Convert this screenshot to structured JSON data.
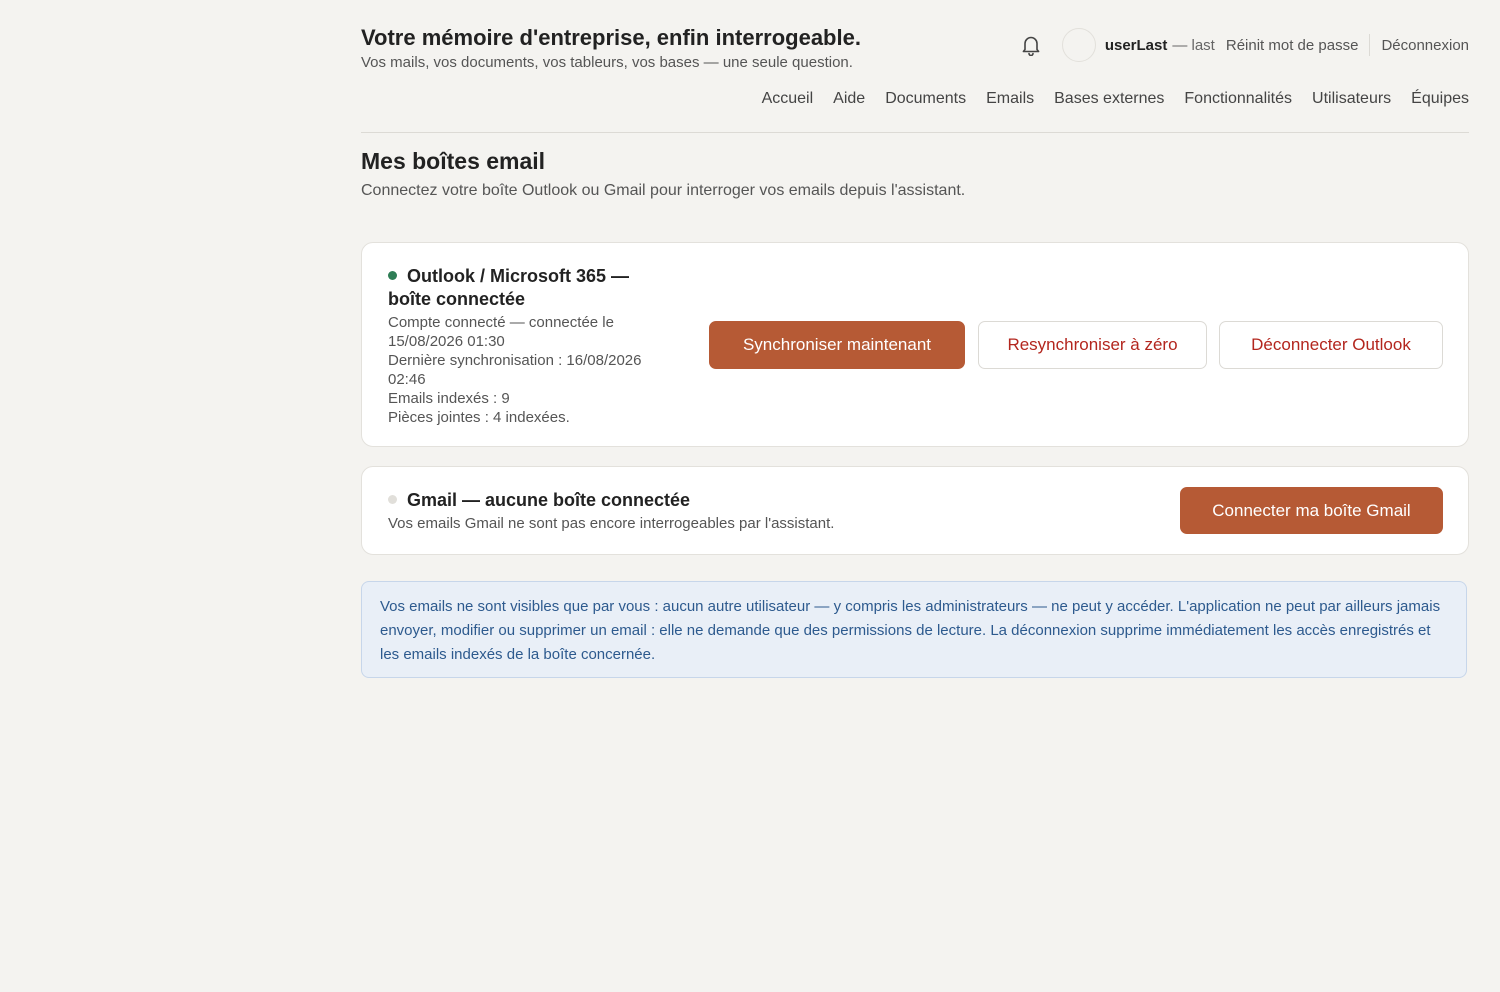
{
  "header": {
    "title": "Votre mémoire d'entreprise, enfin interrogeable.",
    "subtitle": "Vos mails, vos documents, vos tableurs, vos bases — une seule question.",
    "user": {
      "name": "userLast",
      "suffix": "— last",
      "reset_password": "Réinit mot de passe",
      "logout": "Déconnexion"
    },
    "nav": [
      "Accueil",
      "Aide",
      "Documents",
      "Emails",
      "Bases externes",
      "Fonctionnalités",
      "Utilisateurs",
      "Équipes"
    ]
  },
  "section": {
    "title": "Mes boîtes email",
    "description": "Connectez votre boîte Outlook ou Gmail pour interroger vos emails depuis l'assistant."
  },
  "outlook": {
    "title_line1": "Outlook / Microsoft 365 —",
    "title_line2": "boîte connectée",
    "meta_line1": "Compte connecté — connectée le",
    "meta_line2": "15/08/2026 01:30",
    "meta_line3": "Dernière synchronisation : 16/08/2026",
    "meta_line4": "02:46",
    "meta_line5": "Emails indexés : 9",
    "meta_line6": "Pièces jointes : 4 indexées.",
    "status_color": "#2e7d55",
    "sync_button": "Synchroniser maintenant",
    "resync_button": "Resynchroniser à zéro",
    "disconnect_button": "Déconnecter Outlook"
  },
  "gmail": {
    "title": "Gmail — aucune boîte connectée",
    "description": "Vos emails Gmail ne sont pas encore interrogeables par l'assistant.",
    "status_color": "#e1dfda",
    "connect_button": "Connecter ma boîte Gmail"
  },
  "info": {
    "text": "Vos emails ne sont visibles que par vous : aucun autre utilisateur — y compris les administrateurs — ne peut y accéder. L'application ne peut par ailleurs jamais envoyer, modifier ou supprimer un email : elle ne demande que des permissions de lecture. La déconnexion supprime immédiatement les accès enregistrés et les emails indexés de la boîte concernée."
  },
  "colors": {
    "accent": "#b65a35",
    "danger_text": "#b3261e",
    "info_background": "#e9eff7",
    "info_text": "#2d5a8e"
  },
  "icons": {
    "notifications": "bell-icon",
    "user": "avatar"
  }
}
